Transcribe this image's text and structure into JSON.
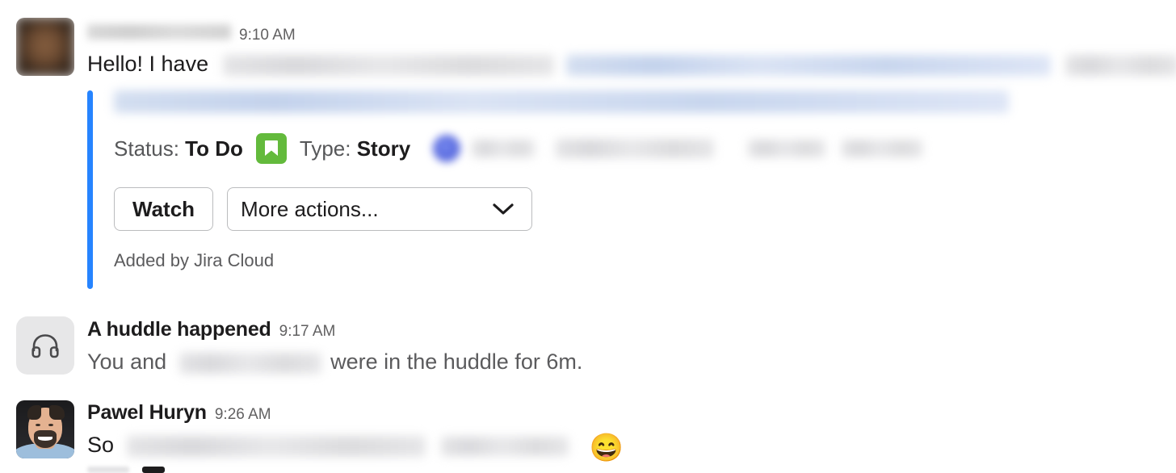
{
  "app": "slack-message-list",
  "colors": {
    "jira_bar_blue": "#2684ff",
    "story_icon_green": "#63ba3c",
    "text_primary": "#1d1c1d",
    "text_secondary": "#616061",
    "huddle_avatar_bg": "#e7e7e8",
    "button_border": "#bbbcbe"
  },
  "messages": [
    {
      "id": "jira-message",
      "sender_name": "",
      "sender_redacted": true,
      "timestamp": "9:10 AM",
      "body_visible": "Hello! I have",
      "body_redacted": true,
      "avatar": "blurred-person-avatar",
      "attachment": {
        "source": "jira-cloud",
        "title_redacted": true,
        "meta": {
          "status_label": "Status:",
          "status_value": "To Do",
          "type_label": "Type:",
          "type_value": "Story",
          "type_icon": "story-bookmark-icon",
          "assignee_avatar": "blurred-blue-avatar",
          "assignee_redacted": true
        },
        "actions": {
          "watch_label": "Watch",
          "more_label": "More actions...",
          "more_chevron": "chevron-down-icon"
        },
        "footer": "Added by Jira Cloud"
      }
    },
    {
      "id": "huddle-message",
      "sender_name": "A huddle happened",
      "timestamp": "9:17 AM",
      "avatar": "headphones-icon",
      "body_prefix": "You and",
      "body_redacted": true,
      "body_suffix": "were in the huddle for 6m."
    },
    {
      "id": "pawel-message",
      "sender_name": "Pawel Huryn",
      "timestamp": "9:26 AM",
      "avatar": "pawel-photo-avatar",
      "body_prefix": "So",
      "body_redacted": true,
      "emoji": "😄"
    }
  ]
}
